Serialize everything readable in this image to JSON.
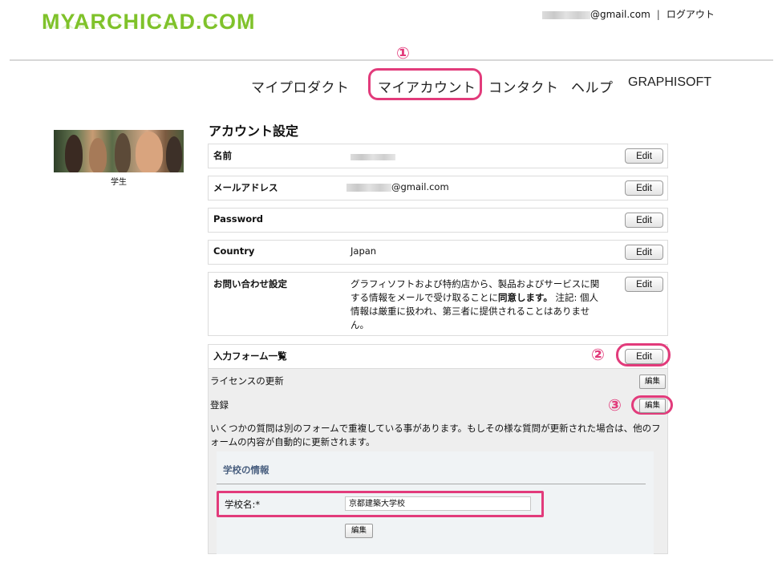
{
  "logo": "MYARCHICAD.COM",
  "header": {
    "user_email_suffix": "@gmail.com",
    "separator": "|",
    "logout": "ログアウト"
  },
  "nav": {
    "items": [
      "マイプロダクト",
      "マイアカウント",
      "コンタクト",
      "ヘルプ",
      "GRAPHISOFT"
    ]
  },
  "annotations": {
    "one": "①",
    "two": "②",
    "three": "③"
  },
  "sidebar": {
    "caption": "学生"
  },
  "account": {
    "title": "アカウント設定",
    "edit_label": "Edit",
    "rows": [
      {
        "label": "名前",
        "value": ""
      },
      {
        "label": "メールアドレス",
        "value": "@gmail.com"
      },
      {
        "label": "Password",
        "value": ""
      },
      {
        "label": "Country",
        "value": "Japan"
      },
      {
        "label": "お問い合わせ設定",
        "value_before": "グラフィソフトおよび特約店から、製品およびサービスに関する情報をメールで受け取ることに",
        "value_bold": "同意します。",
        "value_after": " 注記: 個人情報は厳重に扱われ、第三者に提供されることはありません。"
      }
    ]
  },
  "forms": {
    "title": "入力フォーム一覧",
    "edit_label": "Edit",
    "items": [
      {
        "label": "ライセンスの更新",
        "button": "編集"
      },
      {
        "label": "登録",
        "button": "編集"
      }
    ],
    "note": "いくつかの質問は別のフォームで重複している事があります。もしその様な質問が更新された場合は、他のフォームの内容が自動的に更新されます。",
    "school": {
      "title": "学校の情報",
      "field_label": "学校名:*",
      "field_value": "京都建築大学校",
      "button": "編集"
    }
  },
  "colors": {
    "accent": "#e23b7b",
    "logo": "#7fc22a"
  }
}
